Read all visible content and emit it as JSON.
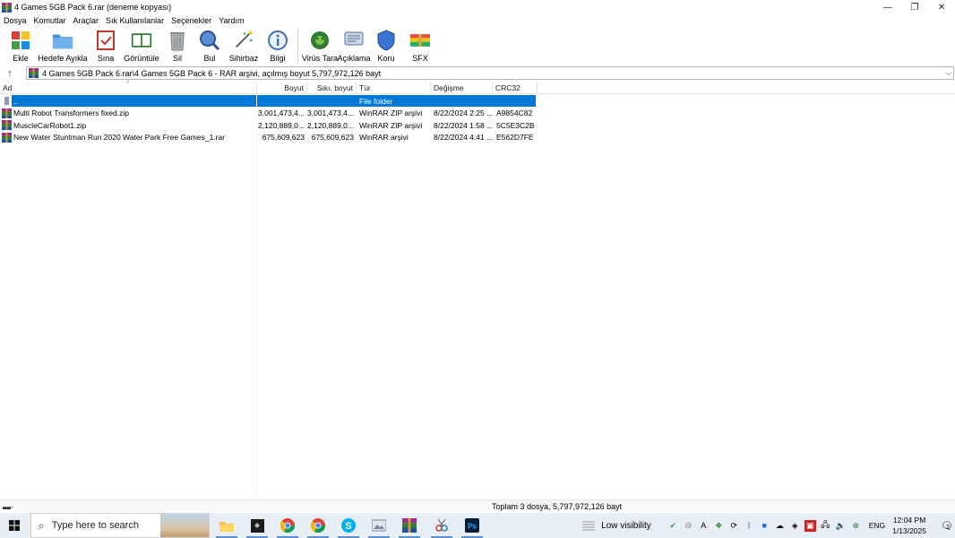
{
  "window": {
    "title": "4 Games 5GB Pack 6.rar (deneme kopyası)",
    "buttons": {
      "minimize": "—",
      "maximize": "❐",
      "close": "✕"
    }
  },
  "menu": [
    "Dosya",
    "Komutlar",
    "Araçlar",
    "Sık Kullanılanlar",
    "Seçenekler",
    "Yardım"
  ],
  "toolbar": [
    {
      "label": "Ekle",
      "icon": "add-archive-icon"
    },
    {
      "label": "Hedefe Ayıkla",
      "icon": "extract-folder-icon"
    },
    {
      "label": "Sına",
      "icon": "test-icon"
    },
    {
      "label": "Görüntüle",
      "icon": "view-book-icon"
    },
    {
      "label": "Sil",
      "icon": "trash-icon"
    },
    {
      "label": "Bul",
      "icon": "find-magnifier-icon"
    },
    {
      "label": "Sihirbaz",
      "icon": "wizard-wand-icon"
    },
    {
      "label": "Bilgi",
      "icon": "info-icon"
    },
    {
      "label": "Virüs Tara",
      "icon": "virus-scan-icon"
    },
    {
      "label": "Açıklama",
      "icon": "comment-icon"
    },
    {
      "label": "Koru",
      "icon": "shield-icon"
    },
    {
      "label": "SFX",
      "icon": "sfx-box-icon"
    }
  ],
  "address": {
    "path": "4 Games 5GB Pack 6.rar\\4 Games 5GB Pack 6 - RAR arşivi, açılmış boyut 5,797,972,126 bayt"
  },
  "columns": [
    "Ad",
    "Boyut",
    "Sıkı. boyut",
    "Tür",
    "Değişme",
    "CRC32"
  ],
  "rows": [
    {
      "name": "..",
      "size": "",
      "packed": "",
      "type": "File folder",
      "modified": "",
      "crc": "",
      "selected": true
    },
    {
      "name": "Multi Robot Transformers fixed.zip",
      "size": "3,001,473,4...",
      "packed": "3,001,473,4...",
      "type": "WinRAR ZIP arşivi",
      "modified": "8/22/2024 2:25 ...",
      "crc": "A9854C82"
    },
    {
      "name": "MuscleCarRobot1.zip",
      "size": "2,120,889,0...",
      "packed": "2,120,889,0...",
      "type": "WinRAR ZIP arşivi",
      "modified": "8/22/2024 1:58 ...",
      "crc": "5C5E3C2B"
    },
    {
      "name": "New Water Stuntman Run 2020 Water Park Free Games_1.rar",
      "size": "675,609,623",
      "packed": "675,609,623",
      "type": "WinRAR arşivi",
      "modified": "8/22/2024 4:41 ...",
      "crc": "E562D7FE"
    }
  ],
  "status": {
    "summary": "Toplam 3 dosya, 5,797,972,126 bayt"
  },
  "taskbar": {
    "search_placeholder": "Type here to search",
    "weather": "Low visibility",
    "language": "ENG",
    "time": "12:04 PM",
    "date": "1/13/2025",
    "notifications": "2"
  }
}
